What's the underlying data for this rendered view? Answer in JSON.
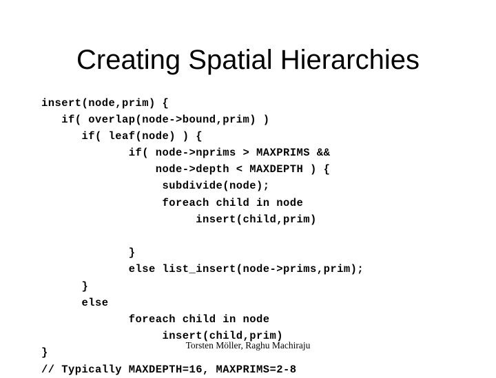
{
  "slide": {
    "title": "Creating Spatial Hierarchies",
    "footer": "Torsten Möller, Raghu Machiraju",
    "background_color": "#ffffff",
    "text_color": "#000000",
    "code_lines": [
      "insert(node,prim) {",
      "   if( overlap(node->bound,prim) )",
      "      if( leaf(node) ) {",
      "             if( node->nprims > MAXPRIMS &&",
      "                 node->depth < MAXDEPTH ) {",
      "                  subdivide(node);",
      "                  foreach child in node",
      "                       insert(child,prim)",
      "",
      "             }",
      "             else list_insert(node->prims,prim);",
      "      }",
      "      else",
      "             foreach child in node",
      "                  insert(child,prim)",
      "}",
      "// Typically MAXDEPTH=16, MAXPRIMS=2-8"
    ]
  }
}
